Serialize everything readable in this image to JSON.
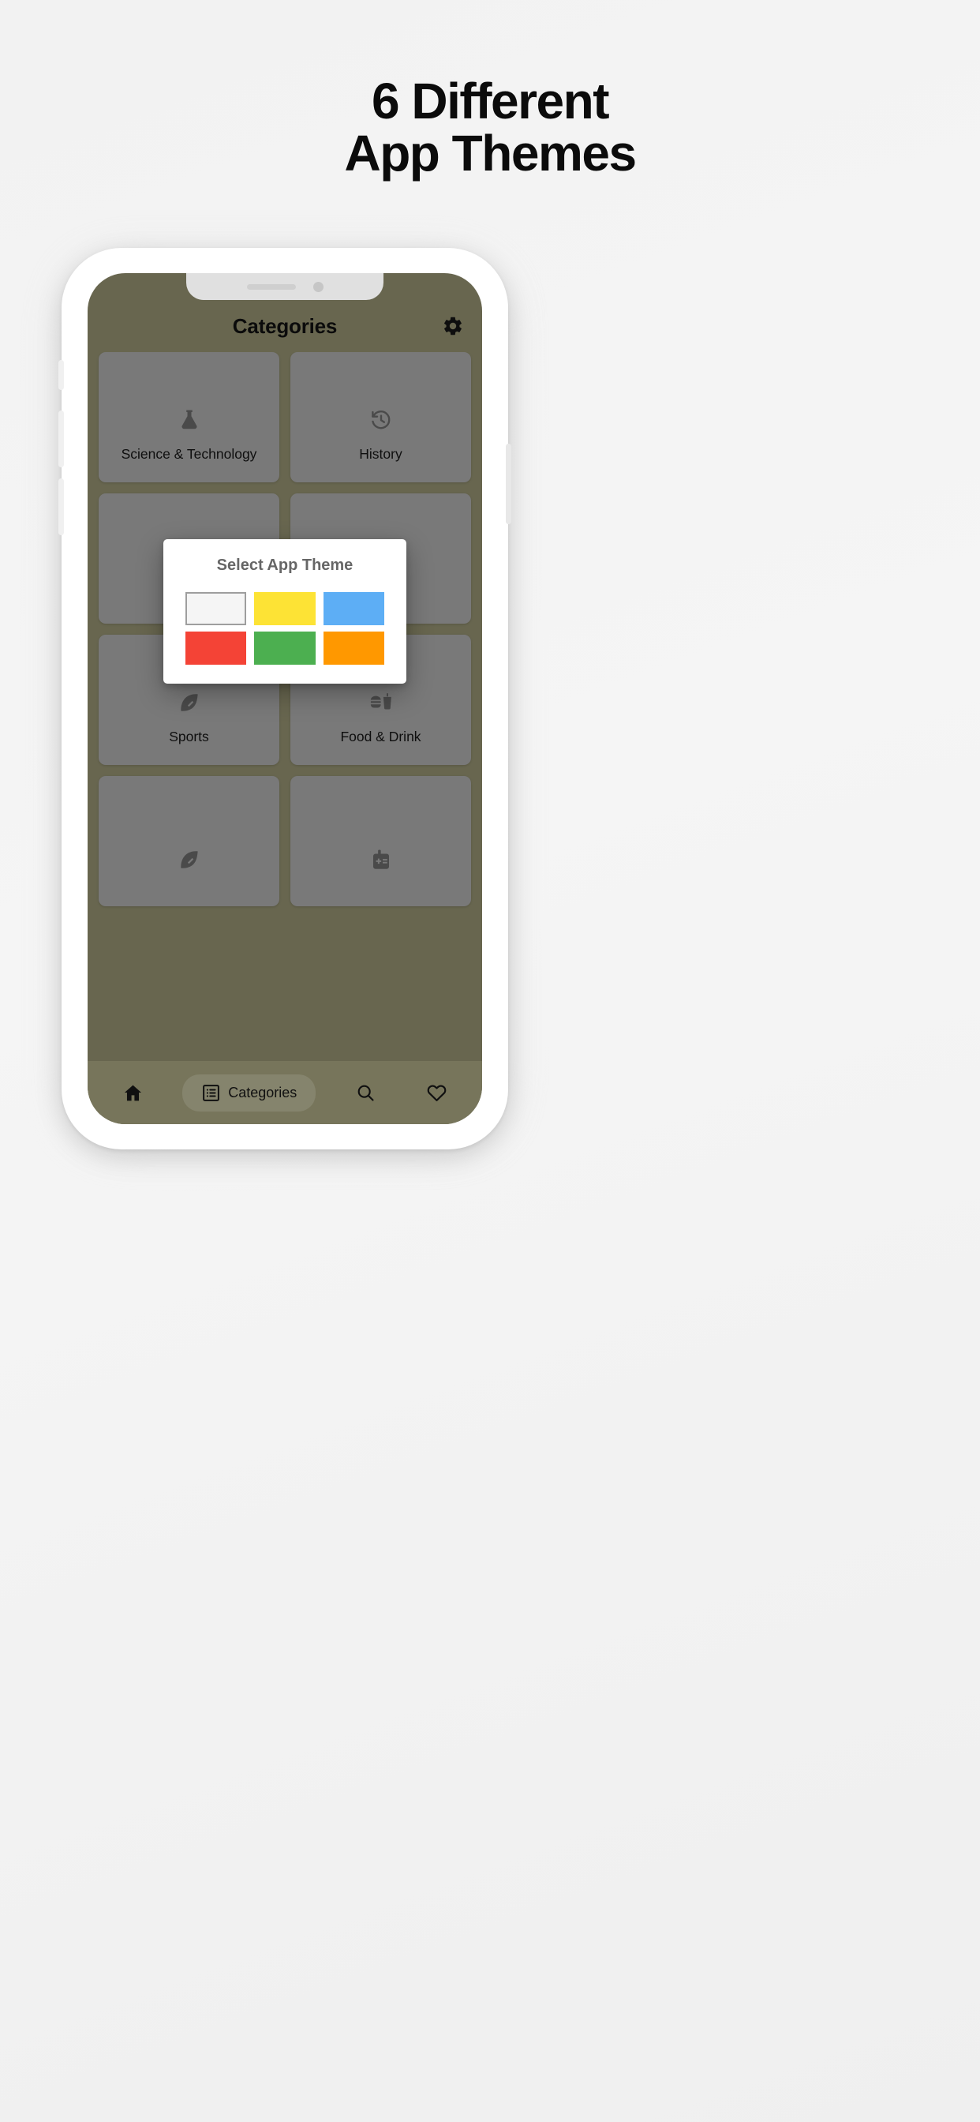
{
  "headline": {
    "line1": "6 Different",
    "line2": "App Themes"
  },
  "phone": {
    "theme_color": "#77755b",
    "tile_color": "#8a8a8a",
    "appbar": {
      "title": "Categories",
      "settings_icon": "gear-icon"
    },
    "categories": [
      {
        "label": "Science & Technology",
        "icon": "flask-icon"
      },
      {
        "label": "History",
        "icon": "history-clock-icon"
      },
      {
        "label": "",
        "icon": ""
      },
      {
        "label": "",
        "icon": ""
      },
      {
        "label": "Sports",
        "icon": "football-icon"
      },
      {
        "label": "Food & Drink",
        "icon": "burger-drink-icon"
      },
      {
        "label": "",
        "icon": "football-icon"
      },
      {
        "label": "",
        "icon": "math-icon"
      }
    ],
    "dialog": {
      "title": "Select App Theme",
      "swatches": [
        {
          "name": "light",
          "color": "#f5f5f5",
          "bordered": true
        },
        {
          "name": "yellow",
          "color": "#fde335",
          "bordered": false
        },
        {
          "name": "blue",
          "color": "#5daef5",
          "bordered": false
        },
        {
          "name": "red",
          "color": "#f44336",
          "bordered": false
        },
        {
          "name": "green",
          "color": "#4caf50",
          "bordered": false
        },
        {
          "name": "orange",
          "color": "#ff9800",
          "bordered": false
        }
      ]
    },
    "bottom_nav": [
      {
        "name": "home",
        "label": "",
        "icon": "home-icon",
        "active": false
      },
      {
        "name": "categories",
        "label": "Categories",
        "icon": "list-icon",
        "active": true
      },
      {
        "name": "search",
        "label": "",
        "icon": "search-icon",
        "active": false
      },
      {
        "name": "favorites",
        "label": "",
        "icon": "heart-icon",
        "active": false
      }
    ]
  }
}
